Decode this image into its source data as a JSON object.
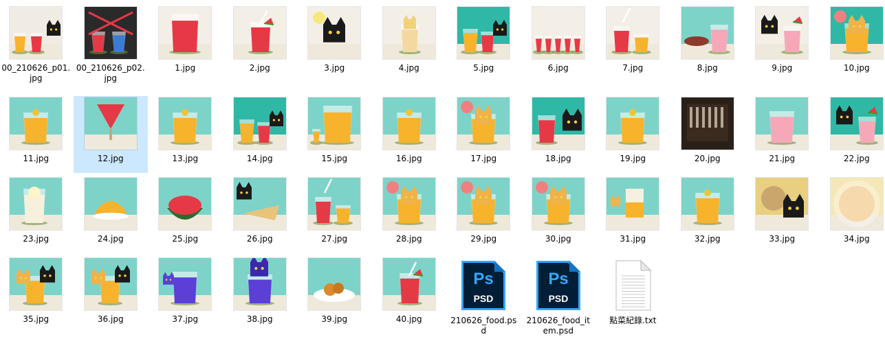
{
  "view": {
    "files": [
      {
        "name": "00_210626_p01.\njpg",
        "type": "jpg",
        "bg": "#f0ece4",
        "art": "cat-drinks"
      },
      {
        "name": "00_210626_p02.\njpg",
        "type": "jpg",
        "bg": "#2a2a2a",
        "art": "crossed-drinks"
      },
      {
        "name": "1.jpg",
        "type": "jpg",
        "bg": "#f3efe6",
        "art": "red-glass"
      },
      {
        "name": "2.jpg",
        "type": "jpg",
        "bg": "#f3efe6",
        "art": "red-glass-melon"
      },
      {
        "name": "3.jpg",
        "type": "jpg",
        "bg": "#f3efe6",
        "art": "black-cat"
      },
      {
        "name": "4.jpg",
        "type": "jpg",
        "bg": "#f3efe6",
        "art": "cat-in-glass"
      },
      {
        "name": "5.jpg",
        "type": "jpg",
        "bg": "#2fb8a6",
        "art": "two-drinks-cat"
      },
      {
        "name": "6.jpg",
        "type": "jpg",
        "bg": "#f3efe6",
        "art": "many-glasses"
      },
      {
        "name": "7.jpg",
        "type": "jpg",
        "bg": "#f3efe6",
        "art": "two-drinks"
      },
      {
        "name": "8.jpg",
        "type": "jpg",
        "bg": "#7ed3c9",
        "art": "hotdog-drink"
      },
      {
        "name": "9.jpg",
        "type": "jpg",
        "bg": "#f3efe6",
        "art": "cat-pink-drink"
      },
      {
        "name": "10.jpg",
        "type": "jpg",
        "bg": "#2fb8a6",
        "art": "cat-glass"
      },
      {
        "name": "11.jpg",
        "type": "jpg",
        "bg": "#7ed3c9",
        "art": "orange-glass"
      },
      {
        "name": "12.jpg",
        "type": "jpg",
        "bg": "#7ed3c9",
        "art": "watermelon-pop"
      },
      {
        "name": "13.jpg",
        "type": "jpg",
        "bg": "#7ed3c9",
        "art": "orange-glass"
      },
      {
        "name": "14.jpg",
        "type": "jpg",
        "bg": "#2fb8a6",
        "art": "two-drinks-cat"
      },
      {
        "name": "15.jpg",
        "type": "jpg",
        "bg": "#7ed3c9",
        "art": "big-orange"
      },
      {
        "name": "16.jpg",
        "type": "jpg",
        "bg": "#7ed3c9",
        "art": "orange-glass"
      },
      {
        "name": "17.jpg",
        "type": "jpg",
        "bg": "#7ed3c9",
        "art": "cat-glass"
      },
      {
        "name": "18.jpg",
        "type": "jpg",
        "bg": "#2fb8a6",
        "art": "red-cat"
      },
      {
        "name": "19.jpg",
        "type": "jpg",
        "bg": "#7ed3c9",
        "art": "orange-glass"
      },
      {
        "name": "20.jpg",
        "type": "jpg",
        "bg": "#2a201a",
        "art": "dark-text"
      },
      {
        "name": "21.jpg",
        "type": "jpg",
        "bg": "#7ed3c9",
        "art": "pink-glass"
      },
      {
        "name": "22.jpg",
        "type": "jpg",
        "bg": "#2fb8a6",
        "art": "cat-pink-drink"
      },
      {
        "name": "23.jpg",
        "type": "jpg",
        "bg": "#7ed3c9",
        "art": "ice-cream-glass"
      },
      {
        "name": "24.jpg",
        "type": "jpg",
        "bg": "#7ed3c9",
        "art": "shaved-ice"
      },
      {
        "name": "25.jpg",
        "type": "jpg",
        "bg": "#7ed3c9",
        "art": "melon-bowl"
      },
      {
        "name": "26.jpg",
        "type": "jpg",
        "bg": "#7ed3c9",
        "art": "pizza-cat"
      },
      {
        "name": "27.jpg",
        "type": "jpg",
        "bg": "#7ed3c9",
        "art": "two-drinks"
      },
      {
        "name": "28.jpg",
        "type": "jpg",
        "bg": "#7ed3c9",
        "art": "cat-glass"
      },
      {
        "name": "29.jpg",
        "type": "jpg",
        "bg": "#7ed3c9",
        "art": "cat-glass"
      },
      {
        "name": "30.jpg",
        "type": "jpg",
        "bg": "#7ed3c9",
        "art": "cat-glass"
      },
      {
        "name": "31.jpg",
        "type": "jpg",
        "bg": "#7ed3c9",
        "art": "juice-box"
      },
      {
        "name": "32.jpg",
        "type": "jpg",
        "bg": "#7ed3c9",
        "art": "orange-glass"
      },
      {
        "name": "33.jpg",
        "type": "jpg",
        "bg": "#e8d080",
        "art": "face-cat"
      },
      {
        "name": "34.jpg",
        "type": "jpg",
        "bg": "#f6e7b8",
        "art": "glow-face"
      },
      {
        "name": "35.jpg",
        "type": "jpg",
        "bg": "#7ed3c9",
        "art": "cats-drink"
      },
      {
        "name": "36.jpg",
        "type": "jpg",
        "bg": "#7ed3c9",
        "art": "cats-drink"
      },
      {
        "name": "37.jpg",
        "type": "jpg",
        "bg": "#7ed3c9",
        "art": "purple-glass"
      },
      {
        "name": "38.jpg",
        "type": "jpg",
        "bg": "#7ed3c9",
        "art": "purple-cat"
      },
      {
        "name": "39.jpg",
        "type": "jpg",
        "bg": "#7ed3c9",
        "art": "fried-chicken"
      },
      {
        "name": "40.jpg",
        "type": "jpg",
        "bg": "#7ed3c9",
        "art": "red-glass-melon"
      },
      {
        "name": "210626_food.ps\nd",
        "type": "psd",
        "badge_top": "Ps",
        "badge_bottom": "PSD"
      },
      {
        "name": "210626_food_it\nem.psd",
        "type": "psd",
        "badge_top": "Ps",
        "badge_bottom": "PSD"
      },
      {
        "name": "點菜紀錄.txt",
        "type": "txt"
      }
    ]
  },
  "colors": {
    "selection": "#cce8ff",
    "teal": "#3cc3b3",
    "psd_dark": "#001e36",
    "psd_blue": "#31a8ff",
    "red_drink": "#e63946",
    "orange_drink": "#f7b32b",
    "purple_drink": "#5b3fd6"
  }
}
